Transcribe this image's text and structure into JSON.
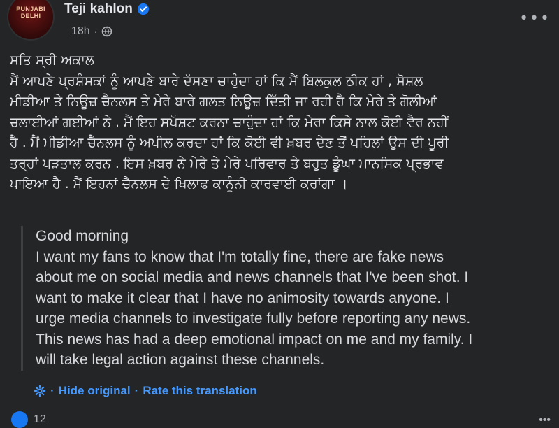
{
  "author": {
    "name": "Teji kahlon",
    "avatar_text": "PUNJABI DELHI",
    "verified": true
  },
  "post_meta": {
    "time": "18h",
    "separator": "·",
    "audience_icon": "globe-icon"
  },
  "more_icon": "more-horizontal-icon",
  "post_lines": [
    "ਸਤਿ ਸ੍ਰੀ ਅਕਾਲ",
    "ਮੈਂ ਆਪਣੇ ਪ੍ਰਸ਼ੰਸਕਾਂ ਨੂੰ ਆਪਣੇ ਬਾਰੇ ਦੱਸਣਾ ਚਾਹੁੰਦਾ ਹਾਂ ਕਿ ਮੈਂ ਬਿਲਕੁਲ ਠੀਕ ਹਾਂ , ਸੋਸ਼ਲ",
    "ਮੀਡੀਆ ਤੇ ਨਿਊਜ਼ ਚੈਨਲਸ ਤੇ ਮੇਰੇ ਬਾਰੇ ਗਲਤ ਨਿਊਜ਼ ਦਿੱਤੀ ਜਾ ਰਹੀ ਹੈ ਕਿ ਮੇਰੇ ਤੇ ਗੋਲੀਆਂ",
    "ਚਲਾਈਆਂ ਗਈਆਂ ਨੇ . ਮੈਂ ਇਹ ਸਪੱਸ਼ਟ ਕਰਨਾ ਚਾਹੁੰਦਾ ਹਾਂ ਕਿ ਮੇਰਾ ਕਿਸੇ ਨਾਲ ਕੋਈ ਵੈਰ ਨਹੀਂ",
    "ਹੈ . ਮੈਂ ਮੀਡੀਆ ਚੈਨਲਸ ਨੂੰ ਅਪੀਲ ਕਰਦਾ ਹਾਂ ਕਿ ਕੋਈ ਵੀ ਖ਼ਬਰ ਦੇਣ ਤੋਂ ਪਹਿਲਾਂ ਉਸ ਦੀ ਪੂਰੀ",
    "ਤਰ੍ਹਾਂ ਪੜਤਾਲ ਕਰਨ . ਇਸ ਖ਼ਬਰ ਨੇ ਮੇਰੇ ਤੇ ਮੇਰੇ ਪਰਿਵਾਰ ਤੇ ਬਹੁਤ ਡੂੰਘਾ ਮਾਨਸਿਕ ਪ੍ਰਭਾਵ",
    "ਪਾਇਆ ਹੈ . ਮੈਂ ਇਹਨਾਂ ਚੈਨਲਸ ਦੇ ਖਿਲਾਫ ਕਾਨੂੰਨੀ ਕਾਰਵਾਈ ਕਰਾਂਗਾ ।"
  ],
  "translation_lines": [
    "Good morning",
    "I want my fans to know that I'm totally fine, there are fake news",
    "about me on social media and news channels that I've been shot. I",
    "want to make it clear that I have no animosity towards anyone. I",
    "urge media channels to investigate fully before reporting any news.",
    "This news has had a deep emotional impact on me and my family. I",
    "will take legal action against these channels."
  ],
  "translation_links": {
    "hide_original": "Hide original",
    "separator": "·",
    "rate_translation": "Rate this translation"
  },
  "footer": {
    "reaction_count": "12"
  },
  "colors": {
    "background": "#242526",
    "text": "#e4e6eb",
    "secondary_text": "#b0b3b8",
    "link": "#4599ff",
    "verified_badge": "#1877f2"
  }
}
